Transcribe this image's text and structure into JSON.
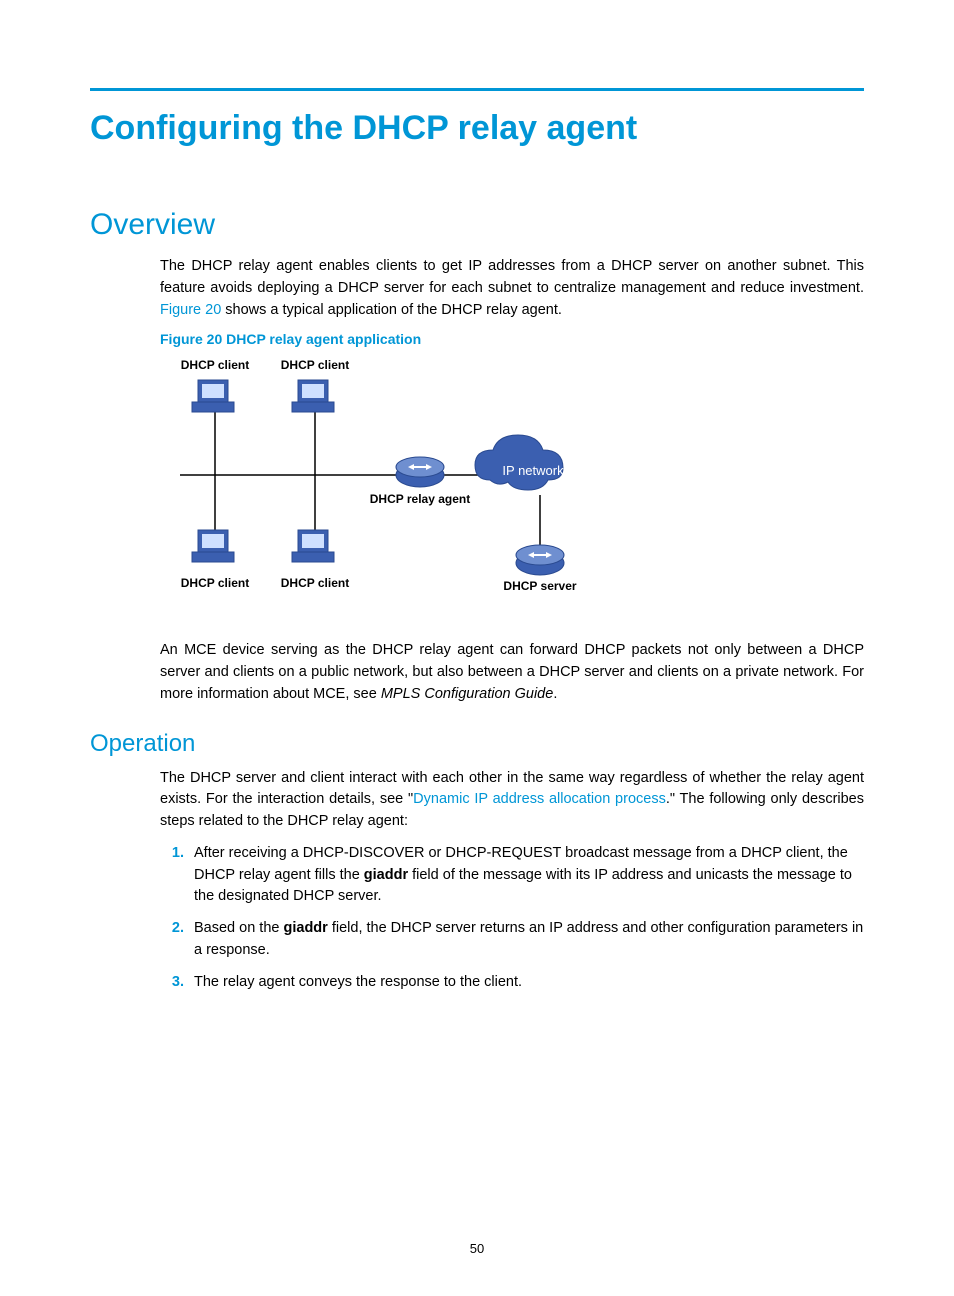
{
  "title": "Configuring the DHCP relay agent",
  "overview": {
    "heading": "Overview",
    "para1_a": "The DHCP relay agent enables clients to get IP addresses from a DHCP server on another subnet. This feature avoids deploying a DHCP server for each subnet to centralize management and reduce investment. ",
    "figref": "Figure 20",
    "para1_b": " shows a typical application of the DHCP relay agent.",
    "fig_caption": "Figure 20 DHCP relay agent application",
    "diagram": {
      "client_tl": "DHCP client",
      "client_tr": "DHCP client",
      "client_bl": "DHCP client",
      "client_br": "DHCP client",
      "relay": "DHCP relay agent",
      "cloud": "IP network",
      "server": "DHCP server"
    },
    "para2_a": "An MCE device serving as the DHCP relay agent can forward DHCP packets not only between a DHCP server and clients on a public network, but also between a DHCP server and clients on a private network. For more information about MCE, see ",
    "para2_ital": "MPLS Configuration Guide",
    "para2_b": "."
  },
  "operation": {
    "heading": "Operation",
    "intro_a": "The DHCP server and client interact with each other in the same way regardless of whether the relay agent exists. For the interaction details, see \"",
    "intro_link": "Dynamic IP address allocation process",
    "intro_b": ".\" The following only describes steps related to the DHCP relay agent:",
    "steps": {
      "s1_a": "After receiving a DHCP-DISCOVER or DHCP-REQUEST broadcast message from a DHCP client, the DHCP relay agent fills the ",
      "s1_bold1": "giaddr",
      "s1_b": " field of the message with its IP address and unicasts the message to the designated DHCP server.",
      "s2_a": "Based on the ",
      "s2_bold1": "giaddr",
      "s2_b": " field, the DHCP server returns an IP address and other configuration parameters in a response.",
      "s3": "The relay agent conveys the response to the client."
    }
  },
  "page_number": "50"
}
